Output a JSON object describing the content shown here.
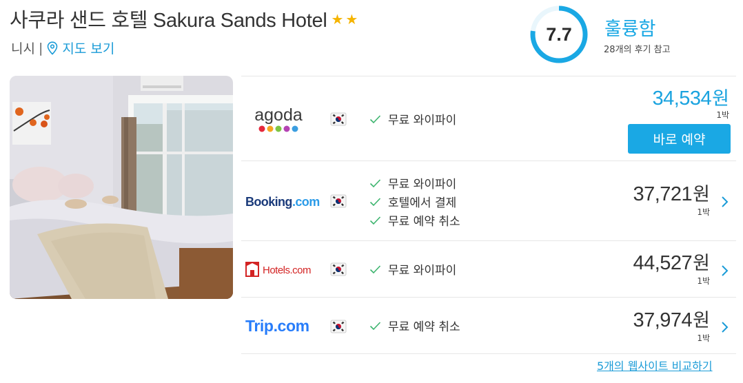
{
  "hotel": {
    "name": "사쿠라 샌드 호텔 Sakura Sands Hotel",
    "star_rating": 2,
    "city": "니시",
    "separator": "|",
    "map_link": "지도 보기"
  },
  "rating": {
    "score": "7.7",
    "score_value": 7.7,
    "score_max": 10,
    "label": "훌륭함",
    "review_count": "28개의 후기 참고"
  },
  "offers": [
    {
      "provider": "agoda",
      "amenities": [
        "무료 와이파이"
      ],
      "price": "34,534",
      "currency": "원",
      "per": "1박",
      "cta": "바로 예약"
    },
    {
      "provider": "Booking.com",
      "amenities": [
        "무료 와이파이",
        "호텔에서 결제",
        "무료 예약 취소"
      ],
      "price": "37,721",
      "currency": "원",
      "per": "1박"
    },
    {
      "provider": "Hotels.com",
      "amenities": [
        "무료 와이파이"
      ],
      "price": "44,527",
      "currency": "원",
      "per": "1박"
    },
    {
      "provider": "Trip.com",
      "amenities": [
        "무료 예약 취소"
      ],
      "price": "37,974",
      "currency": "원",
      "per": "1박"
    }
  ],
  "compare_link": "5개의 웹사이트 비교하기",
  "icons": {
    "map": "map-pin-icon",
    "check": "check-icon",
    "flag": "korea-flag-icon",
    "chevron": "chevron-right-icon",
    "star": "star-icon"
  },
  "colors": {
    "accent": "#1aa8e4",
    "star": "#f5b400",
    "check": "#3cb46e",
    "featured_price": "#1aa3df"
  }
}
